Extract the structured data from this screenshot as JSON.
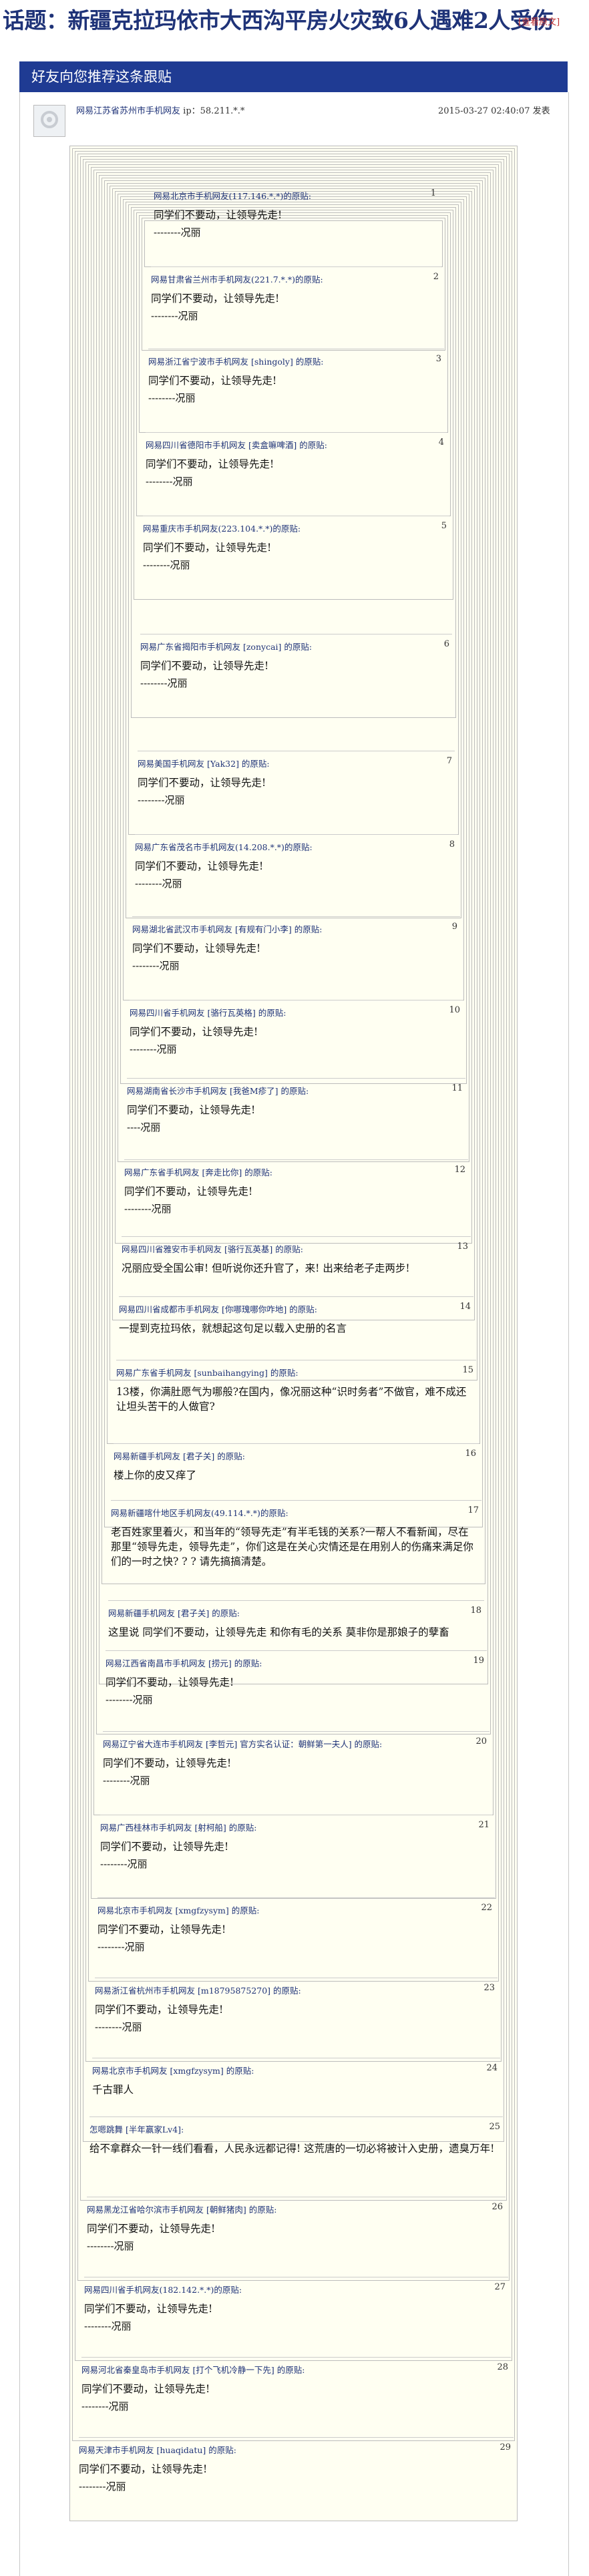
{
  "title": {
    "text": "话题：新疆克拉玛依市大西沟平房火灾致6人遇难2人受伤",
    "view_original": "[查看原文]"
  },
  "section_header": "好友向您推荐这条跟贴",
  "post": {
    "author": "网易江苏省苏州市手机网友",
    "ip_label": "ip：",
    "ip": "58.211.*.*",
    "time": "2015-03-27 02:40:07 发表"
  },
  "replies": [
    {
      "num": "1",
      "author": "网易北京市手机网友(117.146.*.*)的原贴:",
      "text": "同学们不要动，让领导先走!",
      "sig": "--------况丽"
    },
    {
      "num": "2",
      "author": "网易甘肃省兰州市手机网友(221.7.*.*)的原贴:",
      "text": "同学们不要动，让领导先走!",
      "sig": "--------况丽"
    },
    {
      "num": "3",
      "author": "网易浙江省宁波市手机网友 [shingoly] 的原贴:",
      "text": "同学们不要动，让领导先走!",
      "sig": "--------况丽"
    },
    {
      "num": "4",
      "author": "网易四川省德阳市手机网友 [卖盒嘛啤酒] 的原贴:",
      "text": "同学们不要动，让领导先走!",
      "sig": "--------况丽"
    },
    {
      "num": "5",
      "author": "网易重庆市手机网友(223.104.*.*)的原贴:",
      "text": "同学们不要动，让领导先走!",
      "sig": "--------况丽"
    },
    {
      "num": "6",
      "author": "网易广东省揭阳市手机网友 [zonycai] 的原贴:",
      "text": "同学们不要动，让领导先走!",
      "sig": "--------况丽"
    },
    {
      "num": "7",
      "author": "网易美国手机网友 [Yak32] 的原贴:",
      "text": "同学们不要动，让领导先走!",
      "sig": "--------况丽"
    },
    {
      "num": "8",
      "author": "网易广东省茂名市手机网友(14.208.*.*)的原贴:",
      "text": "同学们不要动，让领导先走!",
      "sig": "--------况丽"
    },
    {
      "num": "9",
      "author": "网易湖北省武汉市手机网友 [有规有门小李] 的原贴:",
      "text": "同学们不要动，让领导先走!",
      "sig": "--------况丽"
    },
    {
      "num": "10",
      "author": "网易四川省手机网友 [骆行瓦英格] 的原贴:",
      "text": "同学们不要动，让领导先走!",
      "sig": "--------况丽"
    },
    {
      "num": "11",
      "author": "网易湖南省长沙市手机网友 [我爸M疹了] 的原贴:",
      "text": "同学们不要动，让领导先走!",
      "sig": "----况丽"
    },
    {
      "num": "12",
      "author": "网易广东省手机网友 [奔走比你] 的原贴:",
      "text": "同学们不要动，让领导先走!",
      "sig": "--------况丽"
    },
    {
      "num": "13",
      "author": "网易四川省雅安市手机网友 [骆行瓦英基] 的原贴:",
      "text": "况丽应受全国公审! 但听说你还升官了，来! 出来给老子走两步!",
      "sig": ""
    },
    {
      "num": "14",
      "author": "网易四川省成都市手机网友 [你哪瑰哪你咋地] 的原贴:",
      "text": "一提到克拉玛依，就想起这句足以载入史册的名言",
      "sig": ""
    },
    {
      "num": "15",
      "author": "网易广东省手机网友 [sunbaihangying] 的原贴:",
      "text": "13楼，你满肚愿气为哪般?在国内，像况丽这种“识时务者”不做官，难不成还让坦头苦干的人做官?",
      "sig": ""
    },
    {
      "num": "16",
      "author": "网易新疆手机网友 [君子关] 的原贴:",
      "text": "楼上你的皮又痒了",
      "sig": ""
    },
    {
      "num": "17",
      "author": "网易新疆喀什地区手机网友(49.114.*.*)的原贴:",
      "text": "老百姓家里着火，和当年的“领导先走”有半毛钱的关系?一帮人不看新闻，尽在那里“领导先走，领导先走”，你们这是在关心灾情还是在用别人的伤痛来满足你们的一时之快? ? ? 请先搞搞清楚。",
      "sig": ""
    },
    {
      "num": "18",
      "author": "网易新疆手机网友 [君子关] 的原贴:",
      "text": "这里说 同学们不要动，让领导先走 和你有毛的关系 莫非你是那娘子的孽畜",
      "sig": ""
    },
    {
      "num": "19",
      "author": "网易江西省南昌市手机网友 [捞元] 的原贴:",
      "text": "同学们不要动，让领导先走!",
      "sig": "--------况丽"
    },
    {
      "num": "20",
      "author": "网易辽宁省大连市手机网友 [李哲元] 官方实名认证：朝鲜第一夫人] 的原贴:",
      "text": "同学们不要动，让领导先走!",
      "sig": "--------况丽"
    },
    {
      "num": "21",
      "author": "网易广西桂林市手机网友 [射柯船] 的原贴:",
      "text": "同学们不要动，让领导先走!",
      "sig": "--------况丽"
    },
    {
      "num": "22",
      "author": "网易北京市手机网友 [xmgfzysym] 的原贴:",
      "text": "同学们不要动，让领导先走!",
      "sig": "--------况丽"
    },
    {
      "num": "23",
      "author": "网易浙江省杭州市手机网友 [m18795875270] 的原贴:",
      "text": "同学们不要动，让领导先走!",
      "sig": "--------况丽"
    },
    {
      "num": "24",
      "author": "网易北京市手机网友 [xmgfzysym] 的原贴:",
      "text": "千古罪人",
      "sig": ""
    },
    {
      "num": "25",
      "author": "怎嗯跳舞 [半年赢家Lv4]:",
      "text": "给不拿群众一针一线们看看，人民永远都记得! 这荒唐的一切必将被计入史册，遗臭万年!",
      "sig": ""
    },
    {
      "num": "26",
      "author": "网易黑龙江省哈尔滨市手机网友 [朝鲜猪肉] 的原贴:",
      "text": "同学们不要动，让领导先走!",
      "sig": "--------况丽"
    },
    {
      "num": "27",
      "author": "网易四川省手机网友(182.142.*.*)的原贴:",
      "text": "同学们不要动，让领导先走!",
      "sig": "--------况丽"
    },
    {
      "num": "28",
      "author": "网易河北省秦皇岛市手机网友 [打个飞机冷静一下先] 的原贴:",
      "text": "同学们不要动，让领导先走!",
      "sig": "--------况丽"
    },
    {
      "num": "29",
      "author": "网易天津市手机网友 [huaqidatu] 的原贴:",
      "text": "同学们不要动，让领导先走!",
      "sig": "--------况丽"
    }
  ],
  "colors": {
    "header_bar": "#1f3b93",
    "title": "#1f3378",
    "quote_bg": "#fffff2",
    "link_red": "#c03030"
  }
}
